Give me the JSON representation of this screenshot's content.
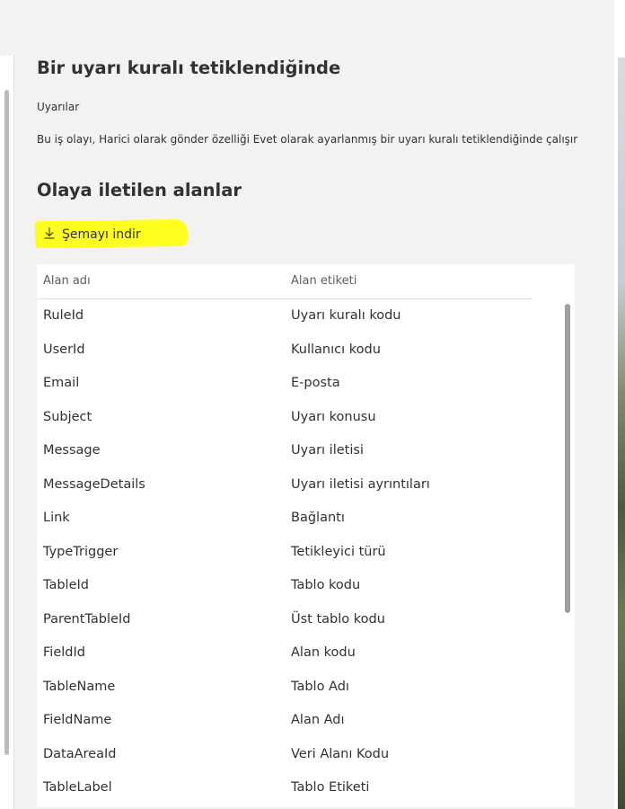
{
  "panel": {
    "title": "Bir uyarı kuralı tetiklendiğinde",
    "subtitle": "Uyarılar",
    "description": "Bu iş olayı, Harici olarak gönder özelliği Evet olarak ayarlanmış bir uyarı kuralı tetiklendiğinde çalışır",
    "section_title": "Olaya iletilen alanlar",
    "download_label": "Şemayı indir"
  },
  "table": {
    "columns": [
      "Alan adı",
      "Alan etiketi"
    ],
    "rows": [
      [
        "RuleId",
        "Uyarı kuralı kodu"
      ],
      [
        "UserId",
        "Kullanıcı kodu"
      ],
      [
        "Email",
        "E-posta"
      ],
      [
        "Subject",
        "Uyarı konusu"
      ],
      [
        "Message",
        "Uyarı iletisi"
      ],
      [
        "MessageDetails",
        "Uyarı iletisi ayrıntıları"
      ],
      [
        "Link",
        "Bağlantı"
      ],
      [
        "TypeTrigger",
        "Tetikleyici türü"
      ],
      [
        "TableId",
        "Tablo kodu"
      ],
      [
        "ParentTableId",
        "Üst tablo kodu"
      ],
      [
        "FieldId",
        "Alan kodu"
      ],
      [
        "TableName",
        "Tablo Adı"
      ],
      [
        "FieldName",
        "Alan Adı"
      ],
      [
        "DataAreaId",
        "Veri Alanı Kodu"
      ],
      [
        "TableLabel",
        "Tablo Etiketi"
      ]
    ]
  },
  "colors": {
    "background": "#f3f2f1",
    "card": "#ffffff",
    "highlight": "#ffff1f",
    "text": "#323130",
    "muted_text": "#605e5c"
  },
  "icons": {
    "download": "download-arrow-icon"
  }
}
